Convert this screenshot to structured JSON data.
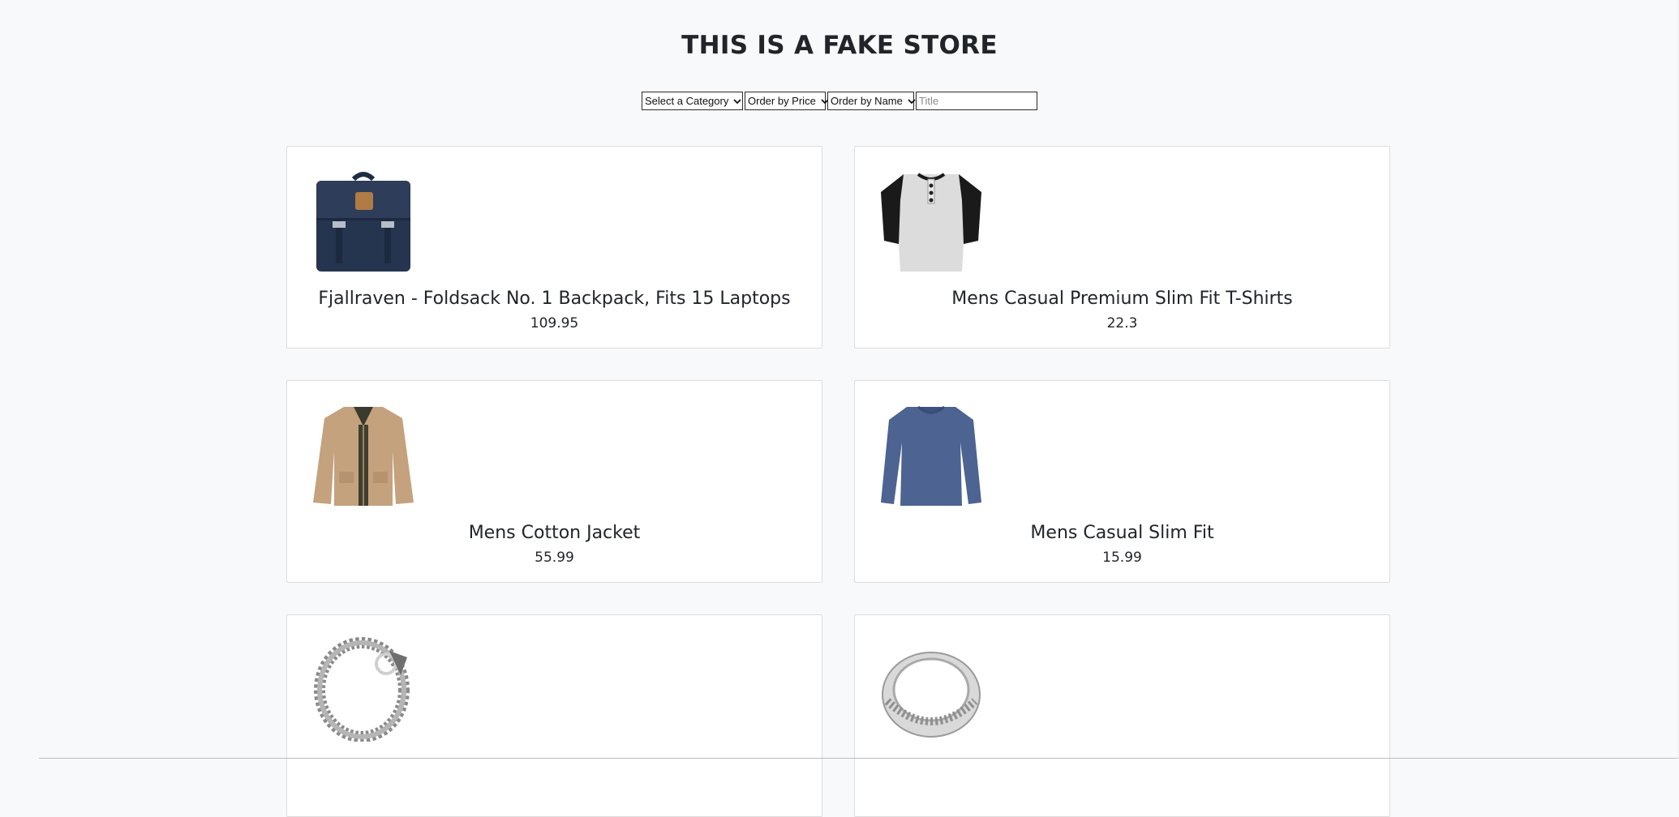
{
  "header": {
    "title": "THIS IS A FAKE STORE"
  },
  "filters": {
    "category": {
      "selected": "Select a Category"
    },
    "price_order": {
      "selected": "Order by Price"
    },
    "name_order": {
      "selected": "Order by Name"
    },
    "title_input": {
      "value": "",
      "placeholder": "Title"
    }
  },
  "products": [
    {
      "name": "Fjallraven - Foldsack No. 1 Backpack, Fits 15 Laptops",
      "price": "109.95",
      "icon": "backpack-image"
    },
    {
      "name": "Mens Casual Premium Slim Fit T-Shirts",
      "price": "22.3",
      "icon": "henley-shirt-image"
    },
    {
      "name": "Mens Cotton Jacket",
      "price": "55.99",
      "icon": "jacket-image"
    },
    {
      "name": "Mens Casual Slim Fit",
      "price": "15.99",
      "icon": "longsleeve-shirt-image"
    },
    {
      "name": "",
      "price": "",
      "icon": "chain-bracelet-image"
    },
    {
      "name": "",
      "price": "",
      "icon": "silver-ring-image"
    }
  ],
  "colors": {
    "background": "#f8f9fa",
    "card": "#ffffff",
    "border": "#dcdcdc"
  }
}
